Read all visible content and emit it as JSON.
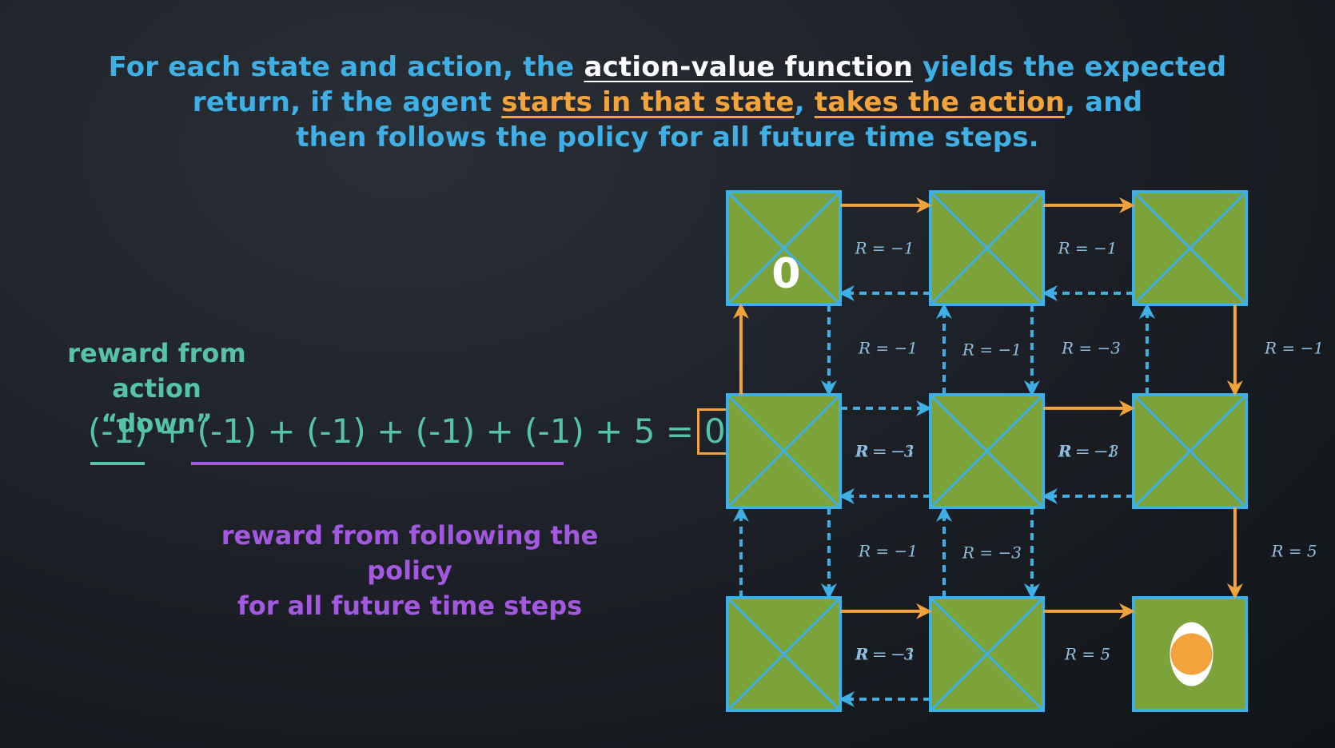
{
  "headline": {
    "line1_a": "For each state and action, the ",
    "line1_b": "action-value function",
    "line1_c": " yields the expected",
    "line2_a": "return, if the agent ",
    "line2_b": "starts in that state",
    "line2_c": ", ",
    "line2_d": "takes the action",
    "line2_e": ", and",
    "line3": "then follows the policy for all future time steps."
  },
  "left_panel": {
    "reward_action_label_1": "reward from",
    "reward_action_label_2": "action “down”",
    "equation": "(-1) + (-1) + (-1) + (-1) + (-1) + 5 =",
    "result": "0",
    "policy_label_1": "reward from following the policy",
    "policy_label_2": "for all future time steps"
  },
  "colors": {
    "blue": "#3fb0e6",
    "orange": "#f2a33c",
    "teal": "#56c3a8",
    "purple": "#a259e0",
    "cell_green": "#7ca33a"
  },
  "grid": {
    "start_value": "0",
    "goal_icon": "target-icon",
    "transitions": [
      {
        "from": [
          0,
          0
        ],
        "dir": "right",
        "style": "solid",
        "color": "orange",
        "label": "R = −1"
      },
      {
        "from": [
          0,
          1
        ],
        "dir": "left",
        "style": "dashed",
        "color": "blue"
      },
      {
        "from": [
          0,
          1
        ],
        "dir": "right",
        "style": "solid",
        "color": "orange",
        "label": "R = −1"
      },
      {
        "from": [
          0,
          2
        ],
        "dir": "left",
        "style": "dashed",
        "color": "blue"
      },
      {
        "from": [
          0,
          0
        ],
        "dir": "down",
        "style": "dashed",
        "color": "blue",
        "label": "R = −1"
      },
      {
        "from": [
          1,
          0
        ],
        "dir": "up",
        "style": "solid",
        "color": "orange"
      },
      {
        "from": [
          0,
          1
        ],
        "dir": "down",
        "style": "dashed",
        "color": "blue",
        "label": "R = −3"
      },
      {
        "from": [
          1,
          1
        ],
        "dir": "up",
        "style": "dashed",
        "color": "blue",
        "label": "R = −1"
      },
      {
        "from": [
          0,
          2
        ],
        "dir": "down",
        "style": "solid",
        "color": "orange",
        "label": "R = −1"
      },
      {
        "from": [
          1,
          2
        ],
        "dir": "up",
        "style": "dashed",
        "color": "blue"
      },
      {
        "from": [
          1,
          0
        ],
        "dir": "right",
        "style": "dashed",
        "color": "blue",
        "label": "R = −3"
      },
      {
        "from": [
          1,
          1
        ],
        "dir": "left",
        "style": "dashed",
        "color": "blue",
        "label": "R = −1"
      },
      {
        "from": [
          1,
          1
        ],
        "dir": "right",
        "style": "solid",
        "color": "orange",
        "label": "R = −1"
      },
      {
        "from": [
          1,
          2
        ],
        "dir": "left",
        "style": "dashed",
        "color": "blue",
        "label": "R = −3"
      },
      {
        "from": [
          1,
          0
        ],
        "dir": "down",
        "style": "dashed",
        "color": "blue",
        "label": "R = −1"
      },
      {
        "from": [
          2,
          0
        ],
        "dir": "up",
        "style": "dashed",
        "color": "blue"
      },
      {
        "from": [
          1,
          1
        ],
        "dir": "down",
        "style": "dashed",
        "color": "blue"
      },
      {
        "from": [
          2,
          1
        ],
        "dir": "up",
        "style": "dashed",
        "color": "blue",
        "label": "R = −3"
      },
      {
        "from": [
          1,
          2
        ],
        "dir": "down",
        "style": "solid",
        "color": "orange",
        "label": "R = 5"
      },
      {
        "from": [
          2,
          0
        ],
        "dir": "right",
        "style": "solid",
        "color": "orange",
        "label": "R = −3"
      },
      {
        "from": [
          2,
          1
        ],
        "dir": "left",
        "style": "dashed",
        "color": "blue",
        "label": "R = −1"
      },
      {
        "from": [
          2,
          1
        ],
        "dir": "right",
        "style": "solid",
        "color": "orange",
        "label": "R = 5"
      }
    ]
  }
}
